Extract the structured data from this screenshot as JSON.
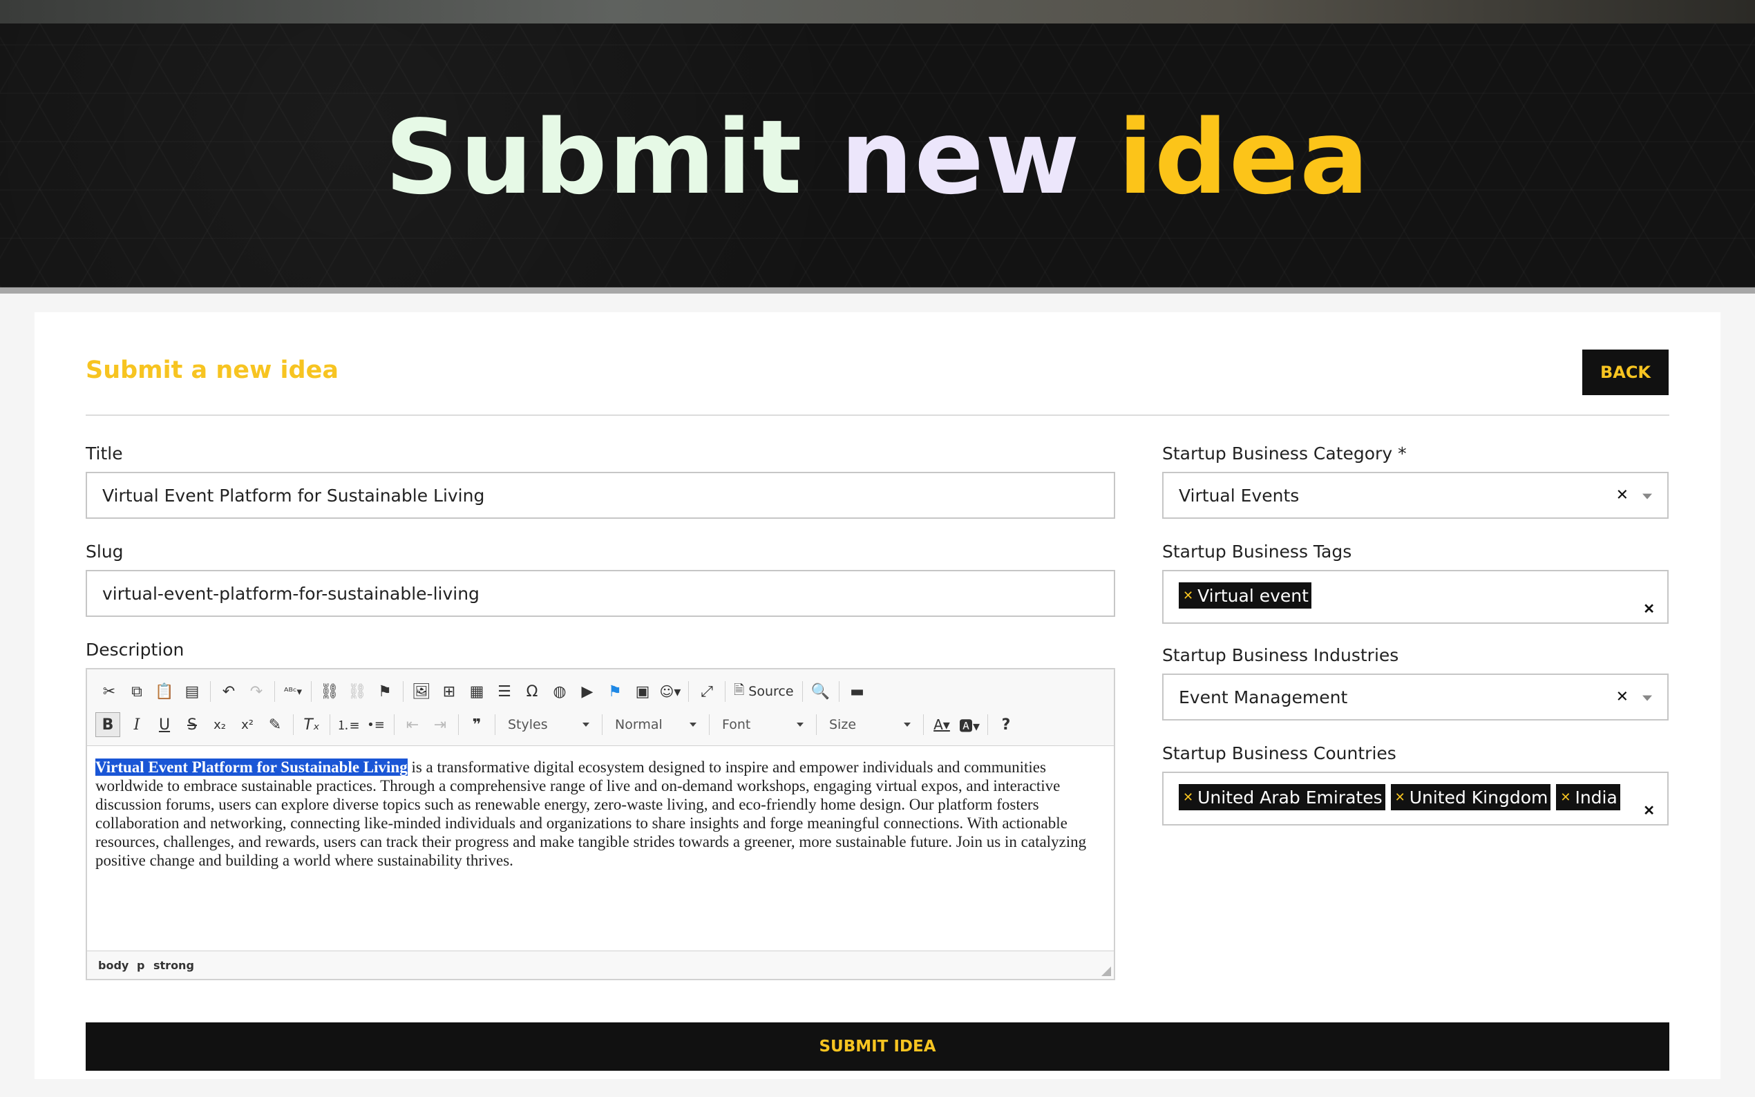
{
  "hero": {
    "title_word_1": "Submit",
    "title_word_2": "new",
    "title_word_3": "idea",
    "colors": {
      "word_1": "#e6f9e6",
      "word_2": "#ece6fb",
      "word_3": "#fcc419",
      "background": "#131313"
    }
  },
  "form": {
    "heading": "Submit a new idea",
    "back_label": "BACK",
    "title_label": "Title",
    "title_value": "Virtual Event Platform for Sustainable Living",
    "slug_label": "Slug",
    "slug_value": "virtual-event-platform-for-sustainable-living",
    "description_label": "Description",
    "submit_label": "SUBMIT IDEA",
    "accent_color": "#f7c421"
  },
  "editor": {
    "toolbar": {
      "source_label": "Source",
      "styles_label": "Styles",
      "format_label": "Normal",
      "font_label": "Font",
      "size_label": "Size"
    },
    "content_highlighted": "Virtual Event Platform for Sustainable Living",
    "content_rest": " is a transformative digital ecosystem designed to inspire and empower individuals and communities worldwide to embrace sustainable practices. Through a comprehensive range of live and on-demand workshops, engaging virtual expos, and interactive discussion forums, users can explore diverse topics such as renewable energy, zero-waste living, and eco-friendly home design. Our platform fosters collaboration and networking, connecting like-minded individuals and organizations to share insights and forge meaningful connections. With actionable resources, challenges, and rewards, users can track their progress and make tangible strides towards a greener, more sustainable future. Join us in catalyzing positive change and building a world where sustainability thrives.",
    "path": [
      "body",
      "p",
      "strong"
    ]
  },
  "sidebar": {
    "category_label": "Startup Business Category *",
    "category_value": "Virtual Events",
    "tags_label": "Startup Business Tags",
    "tags": [
      "Virtual event"
    ],
    "industries_label": "Startup Business Industries",
    "industries_value": "Event Management",
    "countries_label": "Startup Business Countries",
    "countries": [
      "United Arab Emirates",
      "United Kingdom",
      "India"
    ]
  }
}
